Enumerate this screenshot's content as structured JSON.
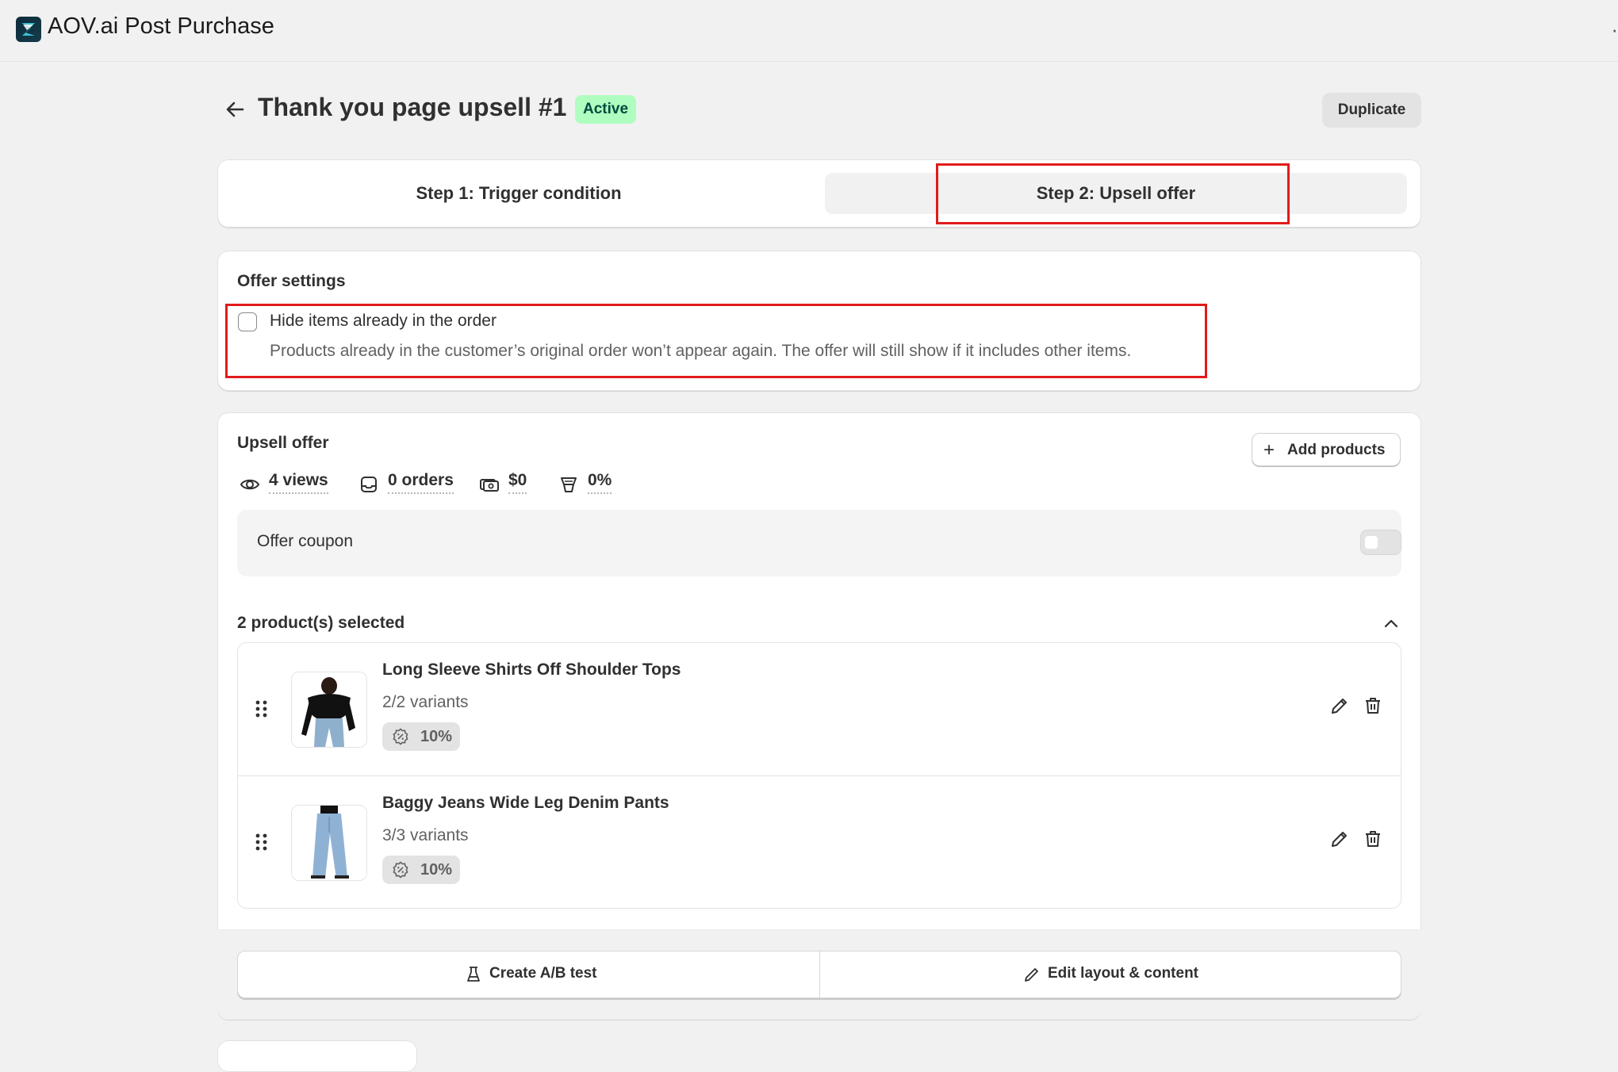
{
  "app": {
    "name": "AOV.ai Post Purchase",
    "overflow": "·"
  },
  "header": {
    "title": "Thank you page upsell #1",
    "status": "Active",
    "duplicate_label": "Duplicate"
  },
  "steps": [
    {
      "label": "Step 1: Trigger condition",
      "selected": false
    },
    {
      "label": "Step 2: Upsell offer",
      "selected": true
    }
  ],
  "offer_settings": {
    "title": "Offer settings",
    "checkbox_label": "Hide items already in the order",
    "checkbox_checked": false,
    "help_text": "Products already in the customer’s original order won’t appear again. The offer will still show if it includes other items."
  },
  "upsell": {
    "title": "Upsell offer",
    "add_products_label": "Add products",
    "stats": {
      "views": "4 views",
      "orders": "0 orders",
      "revenue": "$0",
      "conversion": "0%"
    },
    "coupon": {
      "label": "Offer coupon",
      "enabled": false
    },
    "selected_title": "2 product(s) selected",
    "products": [
      {
        "name": "Long Sleeve Shirts Off Shoulder Tops",
        "variants": "2/2 variants",
        "discount": "10%"
      },
      {
        "name": "Baggy Jeans Wide Leg Denim Pants",
        "variants": "3/3 variants",
        "discount": "10%"
      }
    ],
    "actions": {
      "ab_test_label": "Create A/B test",
      "edit_layout_label": "Edit layout & content"
    }
  },
  "colors": {
    "background": "#f1f1f1",
    "card": "#ffffff",
    "badge_bg": "#affebf",
    "badge_text": "#014b40",
    "highlight": "#e11b1b"
  }
}
